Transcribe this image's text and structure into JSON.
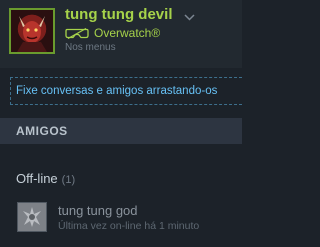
{
  "user": {
    "name": "tung tung devil",
    "game": "Overwatch®",
    "subtitle": "Nos menus",
    "avatar_icon": "devil-avatar",
    "vr_icon": "vr-headset-icon",
    "menu_icon": "chevron-down-icon"
  },
  "drop_hint": "Fixe conversas e amigos arrastando-os",
  "section_header": "AMIGOS",
  "groups": [
    {
      "label": "Off-line",
      "count": "(1)",
      "friends": [
        {
          "name": "tung tung god",
          "status": "Última vez on-line há 1 minuto",
          "avatar_icon": "default-avatar"
        }
      ]
    }
  ],
  "colors": {
    "ingame_green": "#a6d24a",
    "link_blue": "#67c1f5",
    "background": "#1c2229",
    "section_bg": "#2d3541"
  }
}
